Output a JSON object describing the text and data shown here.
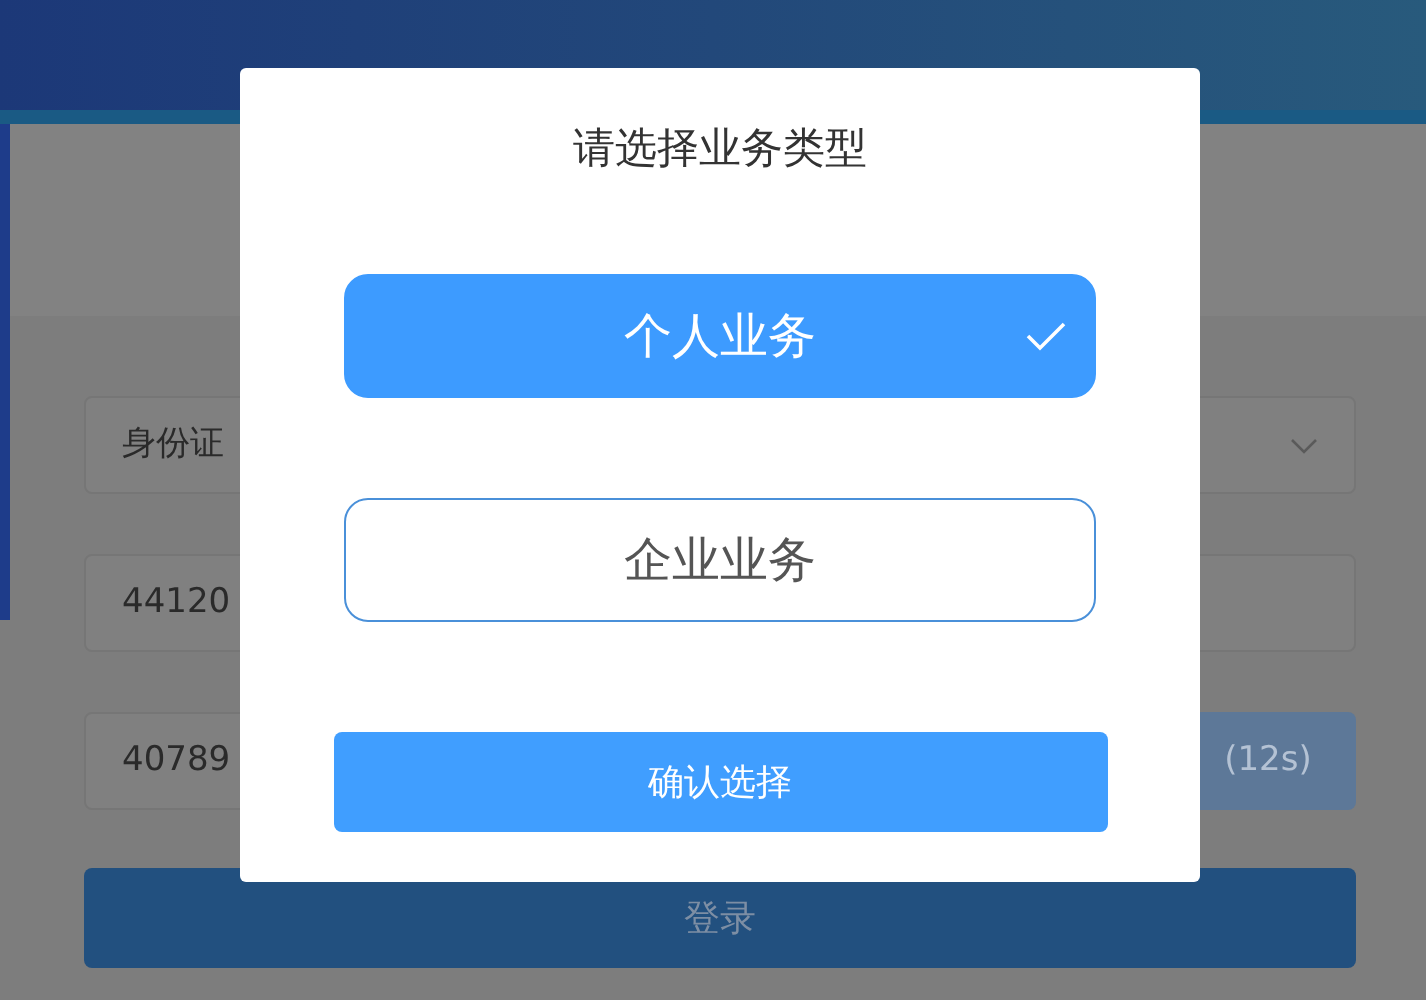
{
  "background": {
    "id_type_select": {
      "value": "身份证"
    },
    "fields": [
      {
        "value": "44120"
      },
      {
        "value": "40789"
      }
    ],
    "code_button": {
      "label": "(12s)",
      "disabled": true
    },
    "login_button": {
      "label": "登录"
    }
  },
  "dialog": {
    "title": "请选择业务类型",
    "options": [
      {
        "label": "个人业务",
        "selected": true
      },
      {
        "label": "企业业务",
        "selected": false
      }
    ],
    "confirm_button": {
      "label": "确认选择"
    }
  }
}
